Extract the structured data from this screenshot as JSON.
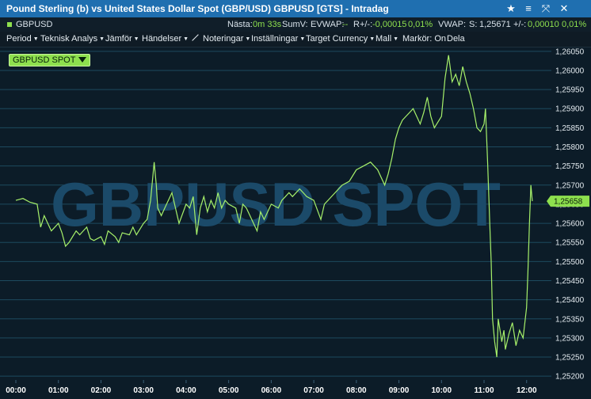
{
  "window": {
    "title": "Pound Sterling (b) vs United States Dollar Spot (GBP/USD) GBPUSD [GTS] - Intradag"
  },
  "titlebar_icons": [
    "star-icon",
    "menu-icon",
    "unpin-icon",
    "close-icon"
  ],
  "infobar": {
    "symbol": "GBPUSD",
    "next_label": "Nästa:",
    "next_value": "0m 33s",
    "sumv_label": "SumV:",
    "evwap_label": "EVWAP:",
    "evwap_value": "--",
    "change_label": "R+/-:",
    "change_value": "-0,00015",
    "change_pct": "0,01%",
    "vwap_label": "VWAP:",
    "s_label": "S:",
    "s_value": "1,25671",
    "pm_label": "+/-:",
    "pm_value": "0,00010",
    "pm_pct": "0,01%"
  },
  "menu": [
    {
      "label": "Period",
      "dropdown": true
    },
    {
      "label": "Teknisk Analys",
      "dropdown": true
    },
    {
      "label": "Jämför",
      "dropdown": true
    },
    {
      "label": "Händelser",
      "dropdown": true
    },
    {
      "label": "Noteringar",
      "dropdown": true
    },
    {
      "label": "Inställningar",
      "dropdown": true
    },
    {
      "label": "Target Currency",
      "dropdown": true
    },
    {
      "label": "Mall",
      "dropdown": true
    },
    {
      "label": "Markör: On",
      "dropdown": false
    },
    {
      "label": "Dela",
      "dropdown": false
    }
  ],
  "colors": {
    "background": "#0c1c28",
    "grid": "#1d4a5e",
    "line": "#a6f06a",
    "watermark": "#1b4a69",
    "price_marker": "#8ee04e",
    "titlebar": "#1f6fb0"
  },
  "series_badge": "GBPUSD SPOT",
  "watermark": "GBPUSD SPOT",
  "current_price_label": "1,25658",
  "chart_data": {
    "type": "line",
    "title": "",
    "xlabel": "",
    "ylabel": "",
    "x_ticks": [
      "00:00",
      "01:00",
      "02:00",
      "03:00",
      "04:00",
      "05:00",
      "06:00",
      "07:00",
      "08:00",
      "09:00",
      "10:00",
      "11:00",
      "12:00"
    ],
    "y_ticks": [
      "1,26050",
      "1,26000",
      "1,25950",
      "1,25900",
      "1,25850",
      "1,25800",
      "1,25750",
      "1,25700",
      "1,25650",
      "1,25600",
      "1,25550",
      "1,25500",
      "1,25450",
      "1,25400",
      "1,25350",
      "1,25300",
      "1,25250",
      "1,25200"
    ],
    "ylim": [
      1.2519,
      1.2606
    ],
    "grid": true,
    "series": [
      {
        "x": [
          "00:00",
          "00:10",
          "00:20",
          "00:30",
          "00:35",
          "00:40",
          "00:45",
          "00:50",
          "01:00",
          "01:05",
          "01:10",
          "01:15",
          "01:20",
          "01:25",
          "01:30",
          "01:40",
          "01:45",
          "01:50",
          "02:00",
          "02:05",
          "02:10",
          "02:20",
          "02:25",
          "02:30",
          "02:40",
          "02:45",
          "02:50",
          "03:00",
          "03:05",
          "03:10",
          "03:15",
          "03:18",
          "03:20",
          "03:25",
          "03:30",
          "03:35",
          "03:40",
          "03:45",
          "03:50",
          "04:00",
          "04:05",
          "04:10",
          "04:15",
          "04:20",
          "04:25",
          "04:30",
          "04:35",
          "04:40",
          "04:45",
          "04:50",
          "04:55",
          "05:00",
          "05:10",
          "05:15",
          "05:20",
          "05:25",
          "05:30",
          "05:40",
          "05:45",
          "05:50",
          "06:00",
          "06:10",
          "06:15",
          "06:20",
          "06:25",
          "06:30",
          "06:40",
          "06:45",
          "06:50",
          "07:00",
          "07:10",
          "07:15",
          "07:20",
          "07:30",
          "07:40",
          "07:50",
          "08:00",
          "08:10",
          "08:20",
          "08:30",
          "08:40",
          "08:45",
          "08:50",
          "08:55",
          "09:00",
          "09:05",
          "09:10",
          "09:15",
          "09:20",
          "09:30",
          "09:35",
          "09:40",
          "09:45",
          "09:50",
          "10:00",
          "10:05",
          "10:10",
          "10:15",
          "10:20",
          "10:25",
          "10:30",
          "10:35",
          "10:40",
          "10:45",
          "10:50",
          "10:55",
          "11:00",
          "11:02",
          "11:05",
          "11:08",
          "11:10",
          "11:12",
          "11:15",
          "11:18",
          "11:20",
          "11:25",
          "11:28",
          "11:30",
          "11:35",
          "11:40",
          "11:45",
          "11:50",
          "11:55",
          "12:00",
          "12:02",
          "12:04",
          "12:06",
          "12:08"
        ],
        "values": [
          1.2566,
          1.25665,
          1.25655,
          1.2565,
          1.2559,
          1.2562,
          1.256,
          1.2558,
          1.256,
          1.25575,
          1.2554,
          1.2555,
          1.25565,
          1.2558,
          1.2557,
          1.2559,
          1.2556,
          1.25555,
          1.25565,
          1.25545,
          1.2558,
          1.25565,
          1.2555,
          1.25575,
          1.2557,
          1.2559,
          1.2557,
          1.256,
          1.2561,
          1.2566,
          1.2576,
          1.257,
          1.2564,
          1.2562,
          1.2564,
          1.2566,
          1.2568,
          1.2564,
          1.256,
          1.2565,
          1.2564,
          1.2567,
          1.2557,
          1.2564,
          1.2567,
          1.2563,
          1.2566,
          1.2564,
          1.2568,
          1.2564,
          1.2566,
          1.2565,
          1.2564,
          1.256,
          1.2565,
          1.2564,
          1.2562,
          1.2558,
          1.2563,
          1.2561,
          1.2565,
          1.2564,
          1.2566,
          1.2567,
          1.2568,
          1.2567,
          1.2569,
          1.2568,
          1.2567,
          1.2566,
          1.2561,
          1.2565,
          1.2566,
          1.2568,
          1.257,
          1.2571,
          1.2574,
          1.2575,
          1.2576,
          1.2574,
          1.257,
          1.2573,
          1.2577,
          1.2582,
          1.2585,
          1.2587,
          1.2588,
          1.2589,
          1.259,
          1.2586,
          1.2589,
          1.2593,
          1.2588,
          1.2585,
          1.2588,
          1.2598,
          1.2604,
          1.2597,
          1.2599,
          1.2596,
          1.2601,
          1.2597,
          1.2594,
          1.259,
          1.2585,
          1.2584,
          1.2586,
          1.259,
          1.2576,
          1.256,
          1.255,
          1.2535,
          1.2529,
          1.2525,
          1.2535,
          1.2529,
          1.2532,
          1.2527,
          1.2531,
          1.2534,
          1.2528,
          1.2532,
          1.253,
          1.2538,
          1.2548,
          1.256,
          1.257,
          1.25658
        ]
      }
    ]
  }
}
